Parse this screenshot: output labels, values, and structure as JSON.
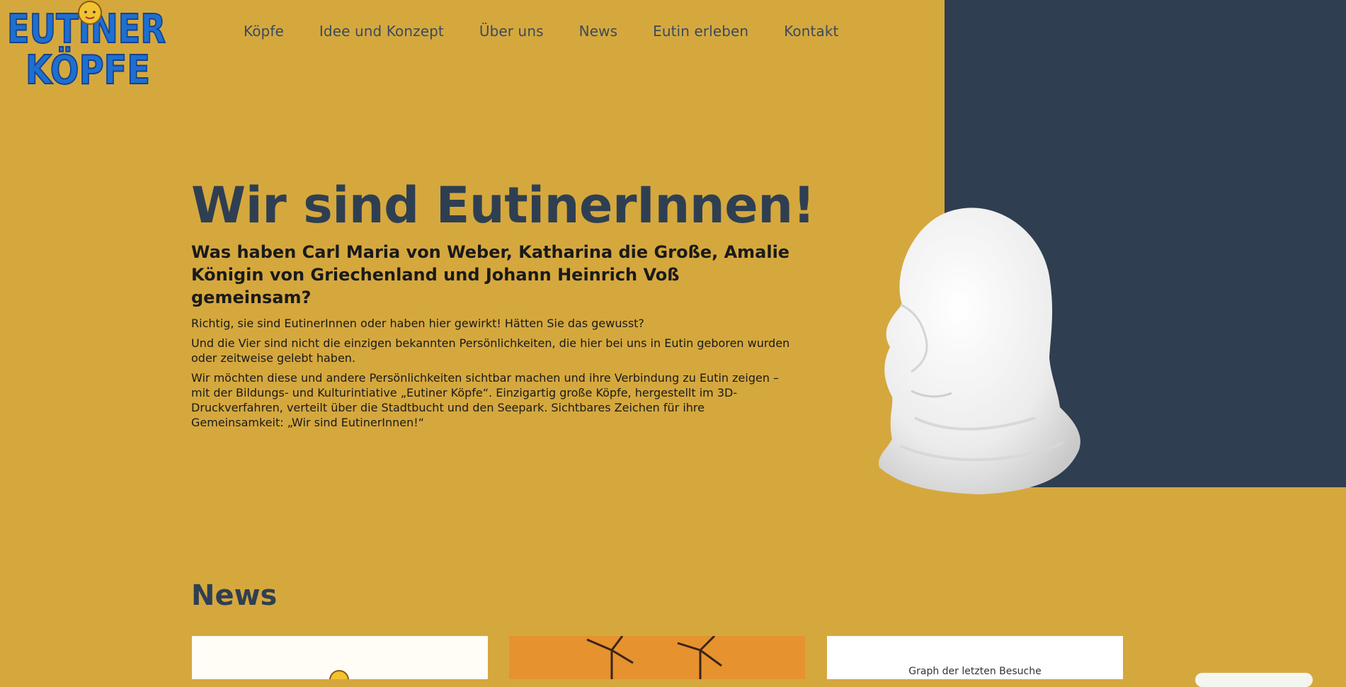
{
  "logo": {
    "line1": "EUTINER",
    "line2": "KÖPFE"
  },
  "nav": {
    "items": [
      {
        "label": "Köpfe"
      },
      {
        "label": "Idee und Konzept"
      },
      {
        "label": "Über uns"
      },
      {
        "label": "News"
      },
      {
        "label": "Eutin erleben"
      },
      {
        "label": "Kontakt"
      }
    ]
  },
  "hero": {
    "title": "Wir sind EutinerInnen!",
    "subtitle": "Was haben Carl Maria von Weber, Katharina die Große, Amalie Königin von Griechenland und Johann Heinrich Voß gemeinsam?",
    "paragraphs": [
      "Richtig, sie sind EutinerInnen oder haben hier gewirkt! Hätten Sie das gewusst?",
      "Und die Vier sind nicht die einzigen bekannten Persönlichkeiten, die hier bei uns in Eutin geboren wurden oder zeitweise gelebt haben.",
      "Wir möchten diese und andere Persönlichkeiten sichtbar machen und ihre Verbindung zu Eutin zeigen – mit der Bildungs- und Kulturintiative „Eutiner Köpfe“. Einzigartig große Köpfe, hergestellt im 3D-Druckverfahren, verteilt über die Stadtbucht und den Seepark. Sichtbares Zeichen für ihre Gemeinsamkeit: „Wir sind EutinerInnen!“"
    ]
  },
  "news": {
    "title": "News",
    "cards": [
      {
        "image": "eutiner-koepfe-logo"
      },
      {
        "image": "wind-turbines-sunset"
      },
      {
        "text": "Graph der letzten Besuche"
      }
    ]
  },
  "colors": {
    "background": "#d5a83e",
    "navy": "#2f3e50",
    "logo_blue": "#1e6fd1"
  }
}
